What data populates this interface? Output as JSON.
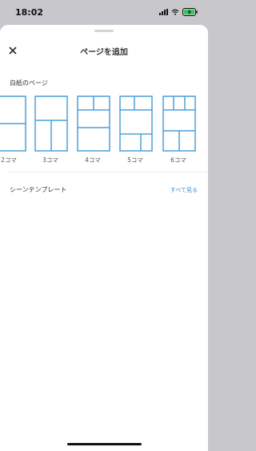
{
  "status_bar": {
    "time": "18:02",
    "icons": [
      "signal-icon",
      "wifi-icon",
      "battery-charging-icon"
    ]
  },
  "sheet": {
    "title": "ページを追加",
    "close_icon": "close-icon",
    "blank_section": {
      "label": "白紙のページ",
      "templates": [
        {
          "label": "2コマ"
        },
        {
          "label": "3コマ"
        },
        {
          "label": "4コマ"
        },
        {
          "label": "5コマ"
        },
        {
          "label": "6コマ"
        }
      ]
    },
    "scene_section": {
      "label": "シーンテンプレート",
      "see_all": "すべて見る"
    }
  },
  "colors": {
    "accent": "#3a92d6",
    "panel_stroke": "#4a9fd8"
  }
}
